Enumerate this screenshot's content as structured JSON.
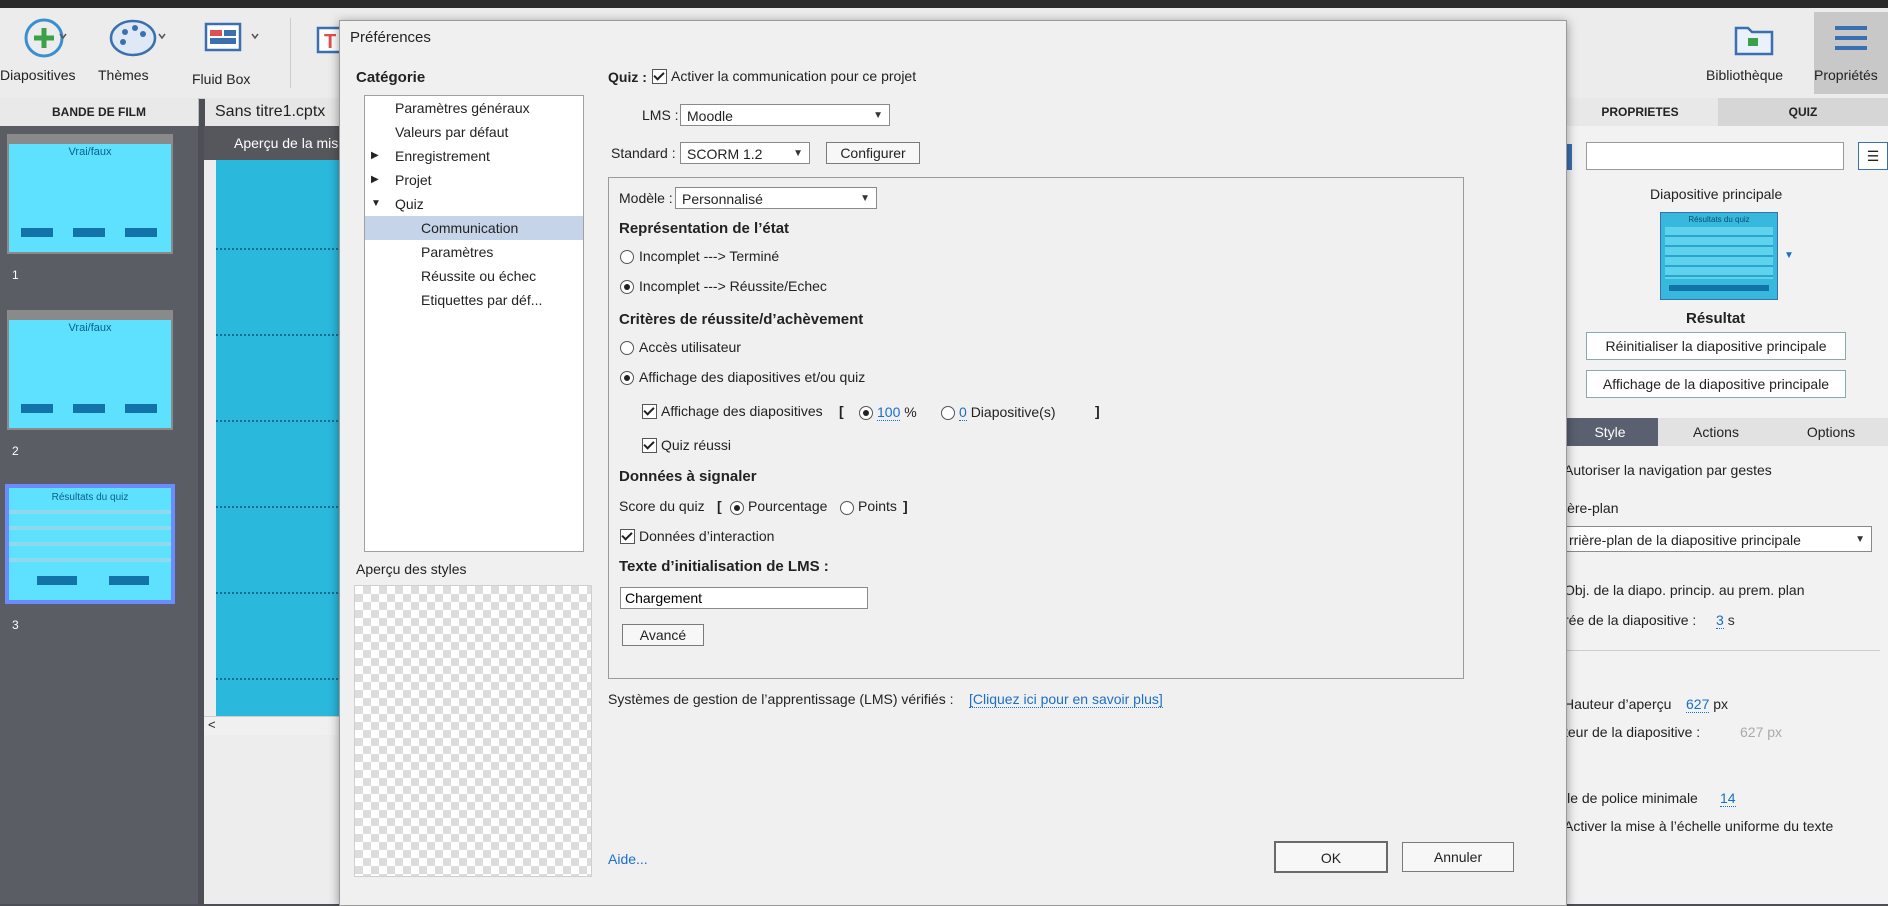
{
  "toolbar": {
    "slides_label": "Diapositives",
    "themes_label": "Thèmes",
    "fluidbox_label": "Fluid Box",
    "text_label": "Te",
    "library_label": "Bibliothèque",
    "properties_label": "Propriétés"
  },
  "filmstrip": {
    "header": "BANDE DE FILM",
    "slides": [
      {
        "number": "1",
        "title": "Vrai/faux"
      },
      {
        "number": "2",
        "title": "Vrai/faux"
      },
      {
        "number": "3",
        "title": "Résultats du quiz"
      }
    ]
  },
  "document": {
    "tab_label": "Sans titre1.cptx",
    "stage_header": "Aperçu de la mis",
    "scroll_left": "<"
  },
  "right_panel": {
    "tab_properties": "PROPRIETES",
    "tab_quiz": "QUIZ",
    "master_slide_label": "Diapositive principale",
    "master_thumb_title": "Résultats du quiz",
    "master_name": "Résultat",
    "reset_master_button": "Réinitialiser la diapositive principale",
    "show_master_button": "Affichage de la diapositive principale",
    "subtab_style": "Style",
    "subtab_actions": "Actions",
    "subtab_options": "Options",
    "gesture_nav": "Autoriser la navigation par gestes",
    "background_label": "ière-plan",
    "background_select": "rrière-plan de la diapositive principale",
    "master_objects_front": "Obj. de la diapo. princip. au prem. plan",
    "slide_duration_label": "rée de la diapositive :",
    "slide_duration_value": "3",
    "slide_duration_unit": "s",
    "preview_height_label": "Hauteur d’aperçu",
    "preview_height_value": "627",
    "preview_height_unit": "px",
    "slide_height_label": "teur de la diapositive :",
    "slide_height_value": "627 px",
    "min_font_label": "lle de police minimale",
    "min_font_value": "14",
    "uniform_scaling": "Activer la mise à l’échelle uniforme du texte"
  },
  "dialog": {
    "title": "Préférences",
    "category_title": "Catégorie",
    "tree": {
      "general": "Paramètres généraux",
      "defaults": "Valeurs par défaut",
      "recording": "Enregistrement",
      "project": "Projet",
      "quiz": "Quiz",
      "communication": "Communication",
      "settings": "Paramètres",
      "pass_fail": "Réussite ou échec",
      "default_labels": "Etiquettes par déf..."
    },
    "style_preview_label": "Aperçu des styles",
    "quiz_prefix": "Quiz :",
    "enable_communication": "Activer la communication pour ce projet",
    "lms_label": "LMS :",
    "lms_value": "Moodle",
    "standard_label": "Standard :",
    "standard_value": "SCORM 1.2",
    "configure_button": "Configurer",
    "template_label": "Modèle :",
    "template_value": "Personnalisé",
    "status_heading": "Représentation de l’état",
    "status_incomplete_complete": "Incomplet ---> Terminé",
    "status_incomplete_passfail": "Incomplet ---> Réussite/Echec",
    "criteria_heading": "Critères de réussite/d’achèvement",
    "user_access": "Accès utilisateur",
    "slide_views_quiz": "Affichage des diapositives et/ou quiz",
    "slide_views": "Affichage des diapositives",
    "bracket_open": "[",
    "percent_value": "100",
    "percent_sign": "%",
    "slides_value": "0",
    "slides_unit": "Diapositive(s)",
    "bracket_close": "]",
    "quiz_passed": "Quiz réussi",
    "data_heading": "Données à signaler",
    "quiz_score_label": "Score du quiz",
    "score_bracket_open": "[",
    "percentage": "Pourcentage",
    "points": "Points",
    "score_bracket_close": "]",
    "interaction_data": "Données d’interaction",
    "lms_init_heading": "Texte d’initialisation de LMS :",
    "lms_init_value": "Chargement",
    "advanced_button": "Avancé",
    "lms_verified_text": "Systèmes de gestion de l’apprentissage (LMS) vérifiés :",
    "lms_verified_link": "[Cliquez ici pour en savoir plus]",
    "help_link": "Aide...",
    "ok_button": "OK",
    "cancel_button": "Annuler"
  }
}
